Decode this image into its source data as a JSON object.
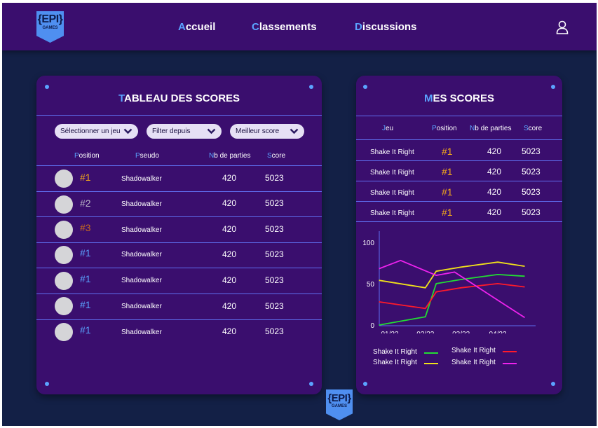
{
  "nav": {
    "logo_brace": "{EPI}",
    "logo_sub": "GAMES",
    "links": [
      {
        "first": "A",
        "rest": "ccueil"
      },
      {
        "first": "C",
        "rest": "lassements"
      },
      {
        "first": "D",
        "rest": "iscussions"
      }
    ],
    "user_icon": "user-icon"
  },
  "leaderboard": {
    "title_first": "T",
    "title_rest": "ABLEAU DES SCORES",
    "filters": [
      "Sélectionner un jeu",
      "Filter depuis",
      "Meilleur score"
    ],
    "columns": [
      {
        "first": "P",
        "rest": "osition"
      },
      {
        "first": "P",
        "rest": "seudo"
      },
      {
        "first": "N",
        "rest": "b de parties"
      },
      {
        "first": "S",
        "rest": "core"
      }
    ],
    "rows": [
      {
        "rank": "#1",
        "rank_color": "#f3a81b",
        "pseudo": "Shadowalker",
        "games": "420",
        "score": "5023"
      },
      {
        "rank": "#2",
        "rank_color": "#b9b4c6",
        "pseudo": "Shadowalker",
        "games": "420",
        "score": "5023"
      },
      {
        "rank": "#3",
        "rank_color": "#c96a1e",
        "pseudo": "Shadowalker",
        "games": "420",
        "score": "5023"
      },
      {
        "rank": "#1",
        "rank_color": "#5ba3ff",
        "pseudo": "Shadowalker",
        "games": "420",
        "score": "5023"
      },
      {
        "rank": "#1",
        "rank_color": "#5ba3ff",
        "pseudo": "Shadowalker",
        "games": "420",
        "score": "5023"
      },
      {
        "rank": "#1",
        "rank_color": "#5ba3ff",
        "pseudo": "Shadowalker",
        "games": "420",
        "score": "5023"
      },
      {
        "rank": "#1",
        "rank_color": "#5ba3ff",
        "pseudo": "Shadowalker",
        "games": "420",
        "score": "5023"
      }
    ]
  },
  "my_scores": {
    "title_first": "M",
    "title_rest": "ES SCORES",
    "columns": [
      {
        "first": "J",
        "rest": "eu"
      },
      {
        "first": "P",
        "rest": "osition"
      },
      {
        "first": "N",
        "rest": "b de parties"
      },
      {
        "first": "S",
        "rest": "core"
      }
    ],
    "rows": [
      {
        "game": "Shake It Right",
        "rank": "#1",
        "games": "420",
        "score": "5023"
      },
      {
        "game": "Shake It Right",
        "rank": "#1",
        "games": "420",
        "score": "5023"
      },
      {
        "game": "Shake It Right",
        "rank": "#1",
        "games": "420",
        "score": "5023"
      },
      {
        "game": "Shake It Right",
        "rank": "#1",
        "games": "420",
        "score": "5023"
      }
    ]
  },
  "colors": {
    "accent": "#5ba3ff",
    "gold": "#f3a81b",
    "background": "#132046",
    "card": "#3a0e6e"
  },
  "chart_data": {
    "type": "line",
    "x": [
      "01/22",
      "02/22",
      "03/22",
      "04/22"
    ],
    "x_positions": [
      0,
      0.33,
      0.66,
      1.0
    ],
    "ylim": [
      0,
      110
    ],
    "yticks": [
      0,
      50,
      100
    ],
    "grid": false,
    "legend_placement": "bottom",
    "series": [
      {
        "name": "Shake It Right",
        "color": "#22dd33",
        "points": [
          [
            -0.1,
            0
          ],
          [
            0.33,
            10
          ],
          [
            0.43,
            50
          ],
          [
            0.66,
            55
          ],
          [
            1.0,
            61
          ],
          [
            1.25,
            59
          ]
        ]
      },
      {
        "name": "Shake It Right",
        "color": "#ff1a2a",
        "points": [
          [
            -0.1,
            28
          ],
          [
            0.33,
            20
          ],
          [
            0.43,
            40
          ],
          [
            0.66,
            45
          ],
          [
            1.0,
            50
          ],
          [
            1.25,
            46
          ]
        ]
      },
      {
        "name": "Shake It Right",
        "color": "#f0e11a",
        "points": [
          [
            -0.1,
            54
          ],
          [
            0.33,
            45
          ],
          [
            0.43,
            65
          ],
          [
            0.66,
            70
          ],
          [
            1.0,
            76
          ],
          [
            1.25,
            71
          ]
        ]
      },
      {
        "name": "Shake It Right",
        "color": "#ee22ee",
        "points": [
          [
            -0.1,
            68
          ],
          [
            0.1,
            78
          ],
          [
            0.43,
            60
          ],
          [
            0.6,
            64
          ],
          [
            1.0,
            30
          ],
          [
            1.25,
            9
          ]
        ]
      }
    ]
  }
}
